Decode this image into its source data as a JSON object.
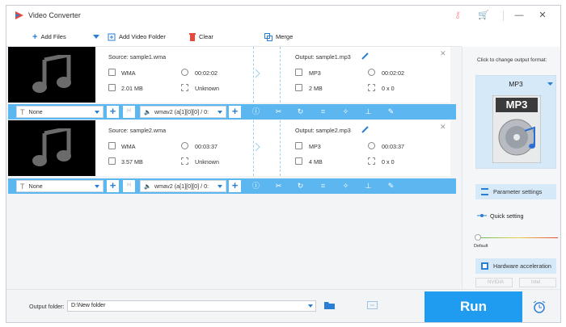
{
  "app": {
    "title": "Video Converter"
  },
  "toolbar": {
    "add_files": "Add Files",
    "add_video_folder": "Add Video Folder",
    "clear": "Clear",
    "merge": "Merge"
  },
  "files": [
    {
      "source": "Source: sample1.wma",
      "src_format": "WMA",
      "src_duration": "00:02:02",
      "src_size": "2.01 MB",
      "src_resolution": "Unknown",
      "output": "Output: sample1.mp3",
      "out_format": "MP3",
      "out_duration": "00:02:02",
      "out_size": "2 MB",
      "out_resolution": "0 x 0",
      "subtitle": "None",
      "audio_track": "wmav2 (a[1][0][0] / 0:"
    },
    {
      "source": "Source: sample2.wma",
      "src_format": "WMA",
      "src_duration": "00:03:37",
      "src_size": "3.57 MB",
      "src_resolution": "Unknown",
      "output": "Output: sample2.mp3",
      "out_format": "MP3",
      "out_duration": "00:03:37",
      "out_size": "4 MB",
      "out_resolution": "0 x 0",
      "subtitle": "None",
      "audio_track": "wmav2 (a[1][0][0] / 0:"
    }
  ],
  "right_panel": {
    "format_prompt": "Click to change output format:",
    "format_name": "MP3",
    "disc_label": "MP3",
    "parameter_settings": "Parameter settings",
    "quick_setting": "Quick setting",
    "quality_default": "Default",
    "hardware_acceleration": "Hardware acceleration",
    "nvidia": "NVIDIA",
    "intel": "Intel"
  },
  "bottom": {
    "output_folder_label": "Output folder:",
    "output_folder_value": "D:\\New folder",
    "run_label": "Run"
  },
  "colors": {
    "accent": "#1f9cf0",
    "edit_bar": "#5cb6ef",
    "selected_format_bg": "#d6e9f9"
  }
}
